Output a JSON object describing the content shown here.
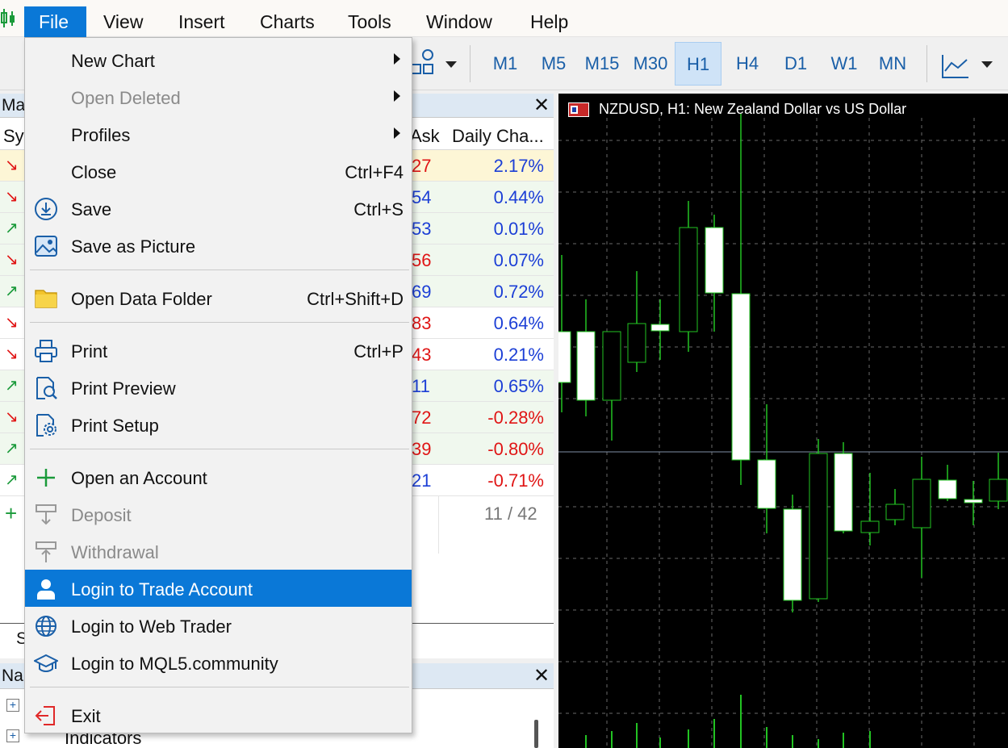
{
  "menubar": {
    "items": [
      "File",
      "View",
      "Insert",
      "Charts",
      "Tools",
      "Window",
      "Help"
    ]
  },
  "toolbar": {
    "timeframes": [
      "M1",
      "M5",
      "M15",
      "M30",
      "H1",
      "H4",
      "D1",
      "W1",
      "MN"
    ],
    "selected_timeframe": "H1"
  },
  "market_watch": {
    "title": "Ma",
    "col_symbol": "Sy",
    "col_ask": "Ask",
    "col_change": "Daily Cha...",
    "rows": [
      {
        "dir": "down",
        "ask": "27",
        "ask_color": "red",
        "change": "2.17%",
        "change_color": "blue"
      },
      {
        "dir": "down",
        "ask": "54",
        "ask_color": "blue",
        "change": "0.44%",
        "change_color": "blue"
      },
      {
        "dir": "up",
        "ask": "53",
        "ask_color": "blue",
        "change": "0.01%",
        "change_color": "blue"
      },
      {
        "dir": "down",
        "ask": "56",
        "ask_color": "red",
        "change": "0.07%",
        "change_color": "blue"
      },
      {
        "dir": "up",
        "ask": "69",
        "ask_color": "blue",
        "change": "0.72%",
        "change_color": "blue"
      },
      {
        "dir": "down",
        "ask": "83",
        "ask_color": "red",
        "change": "0.64%",
        "change_color": "blue"
      },
      {
        "dir": "down",
        "ask": "43",
        "ask_color": "red",
        "change": "0.21%",
        "change_color": "blue"
      },
      {
        "dir": "up",
        "ask": "11",
        "ask_color": "blue",
        "change": "0.65%",
        "change_color": "blue"
      },
      {
        "dir": "down",
        "ask": "72",
        "ask_color": "red",
        "change": "-0.28%",
        "change_color": "red"
      },
      {
        "dir": "up",
        "ask": "39",
        "ask_color": "red",
        "change": "-0.80%",
        "change_color": "red"
      },
      {
        "dir": "up",
        "ask": "21",
        "ask_color": "blue",
        "change": "-0.71%",
        "change_color": "red"
      }
    ],
    "count": "11 / 42",
    "bottom_tab": "S"
  },
  "navigator": {
    "title": "Na",
    "item": "Indicators"
  },
  "chart": {
    "title": "NZDUSD, H1:  New Zealand Dollar vs US Dollar"
  },
  "file_menu": {
    "items": [
      {
        "label": "New Chart",
        "shortcut": "",
        "submenu": true,
        "disabled": false,
        "icon": ""
      },
      {
        "label": "Open Deleted",
        "shortcut": "",
        "submenu": true,
        "disabled": true,
        "icon": ""
      },
      {
        "label": "Profiles",
        "shortcut": "",
        "submenu": true,
        "disabled": false,
        "icon": ""
      },
      {
        "label": "Close",
        "shortcut": "Ctrl+F4",
        "submenu": false,
        "disabled": false,
        "icon": ""
      },
      {
        "label": "Save",
        "shortcut": "Ctrl+S",
        "submenu": false,
        "disabled": false,
        "icon": "save-icon"
      },
      {
        "label": "Save as Picture",
        "shortcut": "",
        "submenu": false,
        "disabled": false,
        "icon": "picture-icon"
      },
      {
        "label": "Open Data Folder",
        "shortcut": "Ctrl+Shift+D",
        "submenu": false,
        "disabled": false,
        "icon": "folder-icon"
      },
      {
        "label": "Print",
        "shortcut": "Ctrl+P",
        "submenu": false,
        "disabled": false,
        "icon": "printer-icon"
      },
      {
        "label": "Print Preview",
        "shortcut": "",
        "submenu": false,
        "disabled": false,
        "icon": "print-preview-icon"
      },
      {
        "label": "Print Setup",
        "shortcut": "",
        "submenu": false,
        "disabled": false,
        "icon": "print-setup-icon"
      },
      {
        "label": "Open an Account",
        "shortcut": "",
        "submenu": false,
        "disabled": false,
        "icon": "plus-icon"
      },
      {
        "label": "Deposit",
        "shortcut": "",
        "submenu": false,
        "disabled": true,
        "icon": "deposit-icon"
      },
      {
        "label": "Withdrawal",
        "shortcut": "",
        "submenu": false,
        "disabled": true,
        "icon": "withdrawal-icon"
      },
      {
        "label": "Login to Trade Account",
        "shortcut": "",
        "submenu": false,
        "disabled": false,
        "icon": "user-icon",
        "highlighted": true
      },
      {
        "label": "Login to Web Trader",
        "shortcut": "",
        "submenu": false,
        "disabled": false,
        "icon": "globe-icon"
      },
      {
        "label": "Login to MQL5.community",
        "shortcut": "",
        "submenu": false,
        "disabled": false,
        "icon": "graduation-cap-icon"
      },
      {
        "label": "Exit",
        "shortcut": "",
        "submenu": false,
        "disabled": false,
        "icon": "exit-icon"
      }
    ]
  },
  "colors": {
    "accent": "#0a78d7",
    "bull": "#ffffff",
    "wick": "#22c322"
  }
}
